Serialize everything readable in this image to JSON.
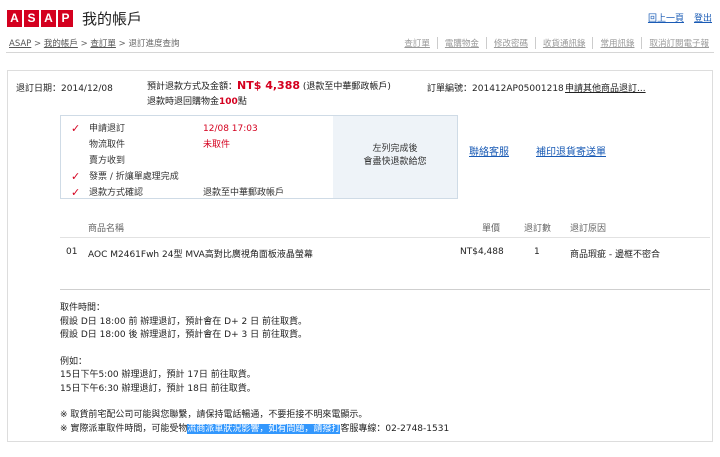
{
  "header": {
    "logo_letters": [
      "A",
      "S",
      "A",
      "P"
    ],
    "title": "我的帳戶",
    "links": [
      "回上一頁",
      "登出"
    ]
  },
  "breadcrumb": {
    "items": [
      "ASAP",
      "我的帳戶",
      "查訂單",
      "退訂進度查詢"
    ],
    "separator": ">"
  },
  "toolbar": [
    "查訂單",
    "電購物金",
    "修改密碼",
    "收貨通訊錄",
    "常用訊錄",
    "取消訂閱電子報"
  ],
  "order": {
    "date_label": "退訂日期：",
    "date": "2014/12/08",
    "refund_label": "預計退款方式及金額：",
    "amount": "NT$ 4,388",
    "refund_method": "(退款至中華郵政帳戶)",
    "points_prefix": "退款時退回購物金",
    "points": "100",
    "points_suffix": "點",
    "order_no_label": "訂單編號：",
    "order_no": "201412AP05001218",
    "other_items_link": "申請其他商品退訂..."
  },
  "status": {
    "steps": [
      {
        "label": "申請退訂",
        "value": "12/08 17:03",
        "checked": true,
        "value_color": "red"
      },
      {
        "label": "物流取件",
        "value": "未取件",
        "checked": false,
        "value_color": "red"
      },
      {
        "label": "賣方收到",
        "value": "",
        "checked": false,
        "value_color": "normal"
      },
      {
        "label": "發票 / 折讓單處理完成",
        "value": "",
        "checked": true,
        "value_color": "normal"
      },
      {
        "label": "退款方式確認",
        "value": "退款至中華郵政帳戶",
        "checked": true,
        "value_color": "normal"
      }
    ],
    "panel_line1": "左列完成後",
    "panel_line2": "會盡快退款給您"
  },
  "actions": {
    "contact": "聯絡客服",
    "reprint": "補印退貨寄送單"
  },
  "table": {
    "headers": [
      "商品名稱",
      "單價",
      "退訂數",
      "退訂原因"
    ],
    "rows": [
      {
        "no": "01",
        "name": "AOC M2461Fwh 24型 MVA高對比廣視角面板液晶螢幕",
        "price": "NT$4,488",
        "qty": "1",
        "reason": "商品瑕疵 - 邊框不密合"
      }
    ]
  },
  "notes": {
    "pickup_title": "取件時間：",
    "pickup_1": "假設 D日 18:00 前 辦理退訂，預計會在 D+ 2 日 前往取貨。",
    "pickup_2": "假設 D日 18:00 後 辦理退訂，預計會在 D+ 3 日 前往取貨。",
    "example_title": "例如：",
    "example_1": "15日下午5:00 辦理退訂，預計 17日 前往取貨。",
    "example_2": "15日下午6:30 辦理退訂，預計 18日 前往取貨。",
    "notice_1": "※ 取貨前宅配公司可能與您聯繫，請保持電話暢通，不要拒接不明來電顯示。",
    "notice_2_pre": "※ 實際派車取件時間，可能受物",
    "notice_2_hl": "流商派車狀況影響，如有問題，請撥打",
    "notice_2_post": "客服專線：02-2748-1531"
  },
  "colors": {
    "brand": "#d4001f",
    "link": "#1a5bb5",
    "highlight": "#3297fd"
  }
}
